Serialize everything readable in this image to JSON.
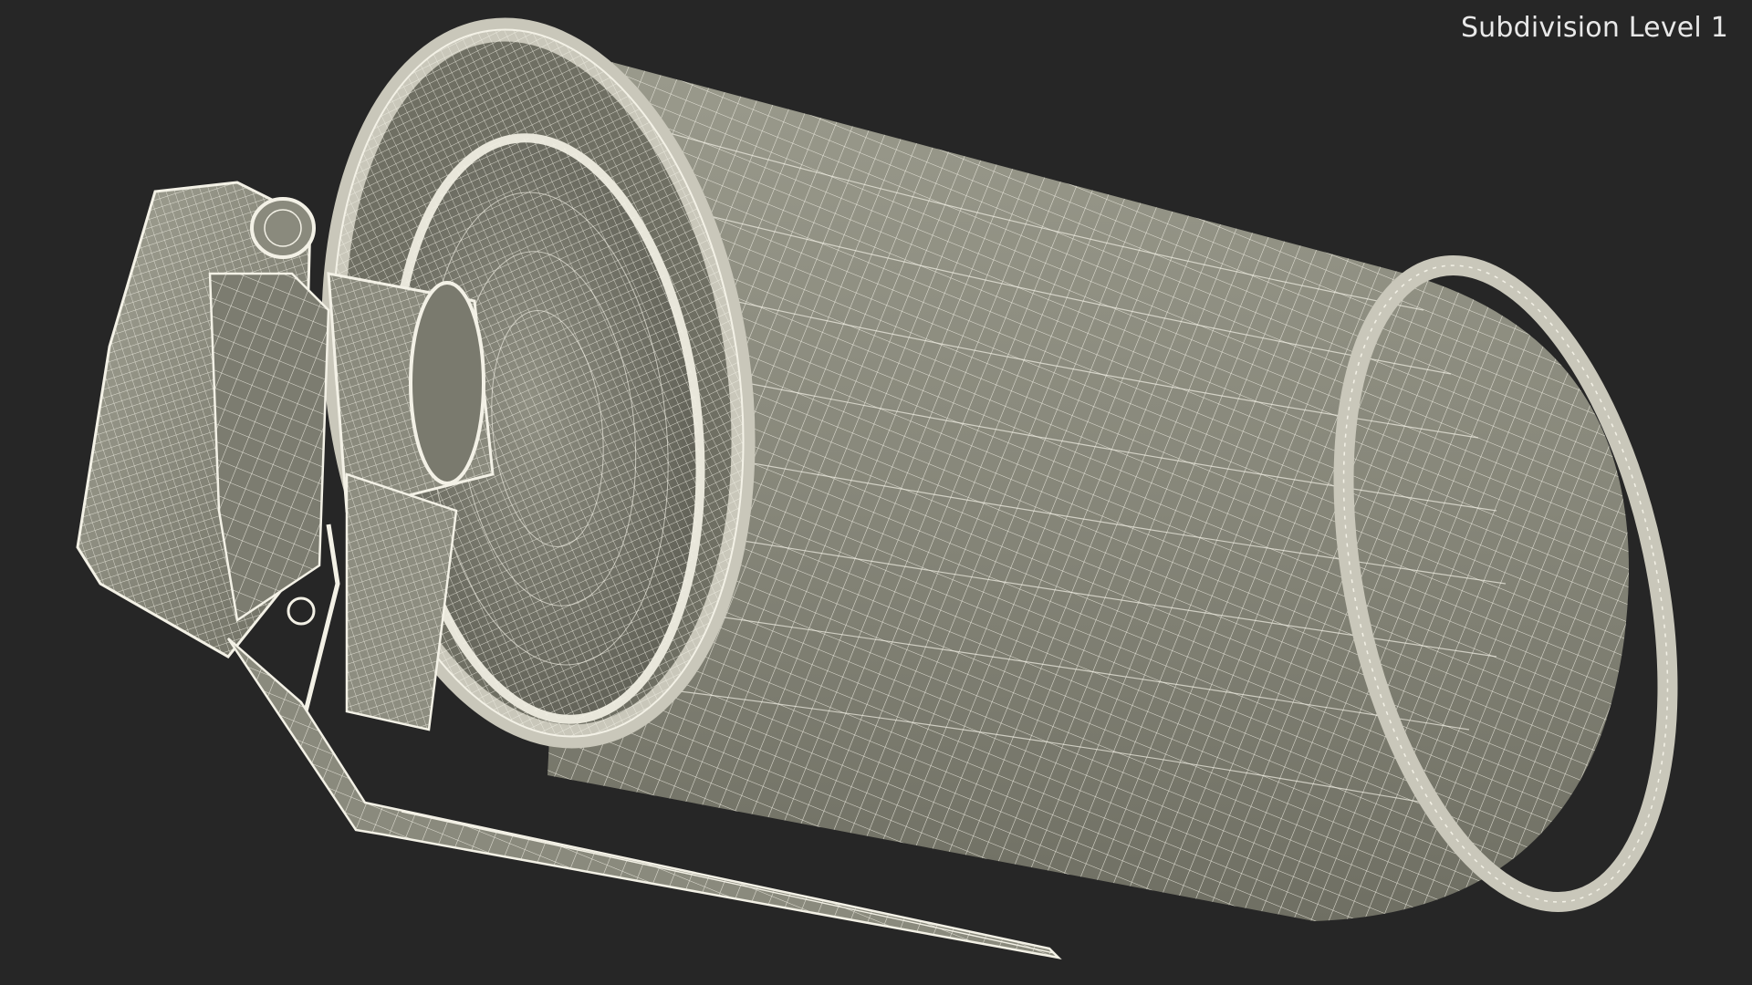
{
  "overlay": {
    "label": "Subdivision Level 1"
  },
  "scene": {
    "subject": "wireframe-model",
    "background_color": "#262626",
    "surface_color": "#8a8a7d",
    "wire_color": "#f3f1e6"
  }
}
